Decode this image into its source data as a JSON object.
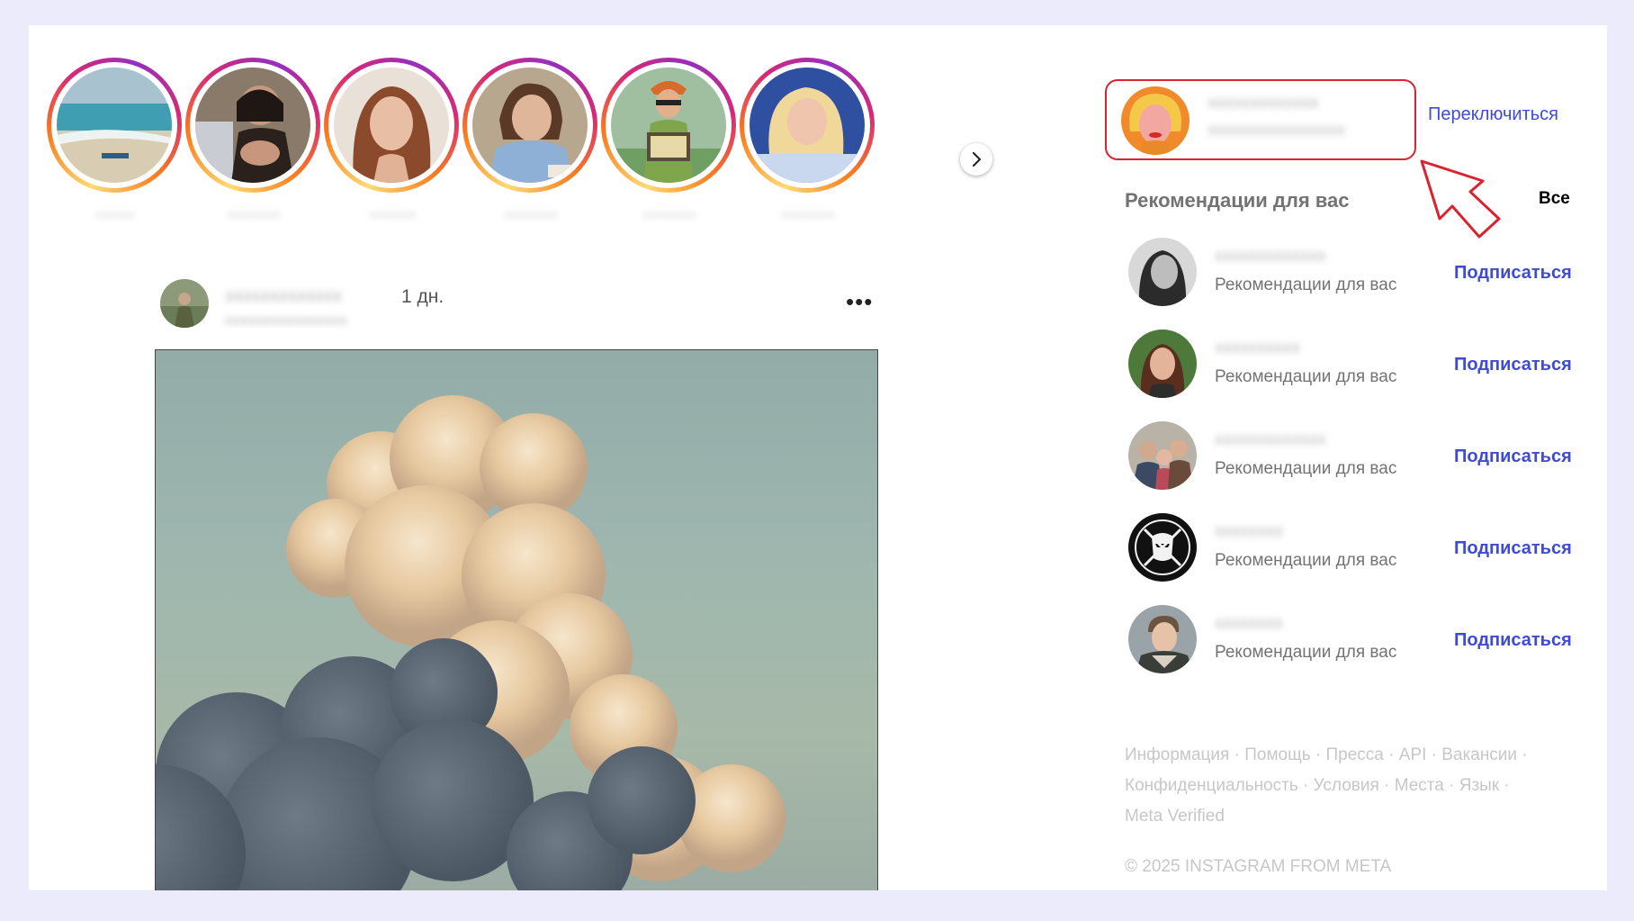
{
  "stories": [
    {
      "username": "xxxxxx",
      "photo": "beach"
    },
    {
      "username": "xxxxxxxx",
      "photo": "woman-dark"
    },
    {
      "username": "xxxxxxx",
      "photo": "woman-red-hair"
    },
    {
      "username": "xxxxxxxx",
      "photo": "woman-blue-dress"
    },
    {
      "username": "xxxxxxxx",
      "photo": "accordion-player"
    },
    {
      "username": "xxxxxxxx",
      "photo": "blonde-woman"
    }
  ],
  "post": {
    "username": "xxxxxxxxxxxxx",
    "time": "1 дн.",
    "subtitle": "xxxxxxxxxxxxxxxx",
    "more_label": "•••"
  },
  "sidebar": {
    "account": {
      "username": "xxxxxxxxxxxxx",
      "fullname": "xxxxxxxxxxxxxxxxx",
      "switch_label": "Переключиться"
    },
    "recommendations_title": "Рекомендации для вас",
    "see_all_label": "Все",
    "suggestions": [
      {
        "username": "xxxxxxxxxxxxx",
        "subtitle": "Рекомендации для вас",
        "follow_label": "Подписаться"
      },
      {
        "username": "xxxxxxxxxx",
        "subtitle": "Рекомендации для вас",
        "follow_label": "Подписаться"
      },
      {
        "username": "xxxxxxxxxxxxx",
        "subtitle": "Рекомендации для вас",
        "follow_label": "Подписаться"
      },
      {
        "username": "xxxxxxxx",
        "subtitle": "Рекомендации для вас",
        "follow_label": "Подписаться"
      },
      {
        "username": "xxxxxxxx",
        "subtitle": "Рекомендации для вас",
        "follow_label": "Подписаться"
      }
    ]
  },
  "footer": {
    "links": [
      "Информация",
      "Помощь",
      "Пресса",
      "API",
      "Вакансии",
      "Конфиденциальность",
      "Условия",
      "Места",
      "Язык",
      "Meta Verified"
    ],
    "copyright": "© 2025 INSTAGRAM FROM META"
  },
  "colors": {
    "page_bg": "#ecebfb",
    "link_blue": "#3e4bd6",
    "highlight_red": "#d9232f",
    "muted_text": "#737373"
  }
}
